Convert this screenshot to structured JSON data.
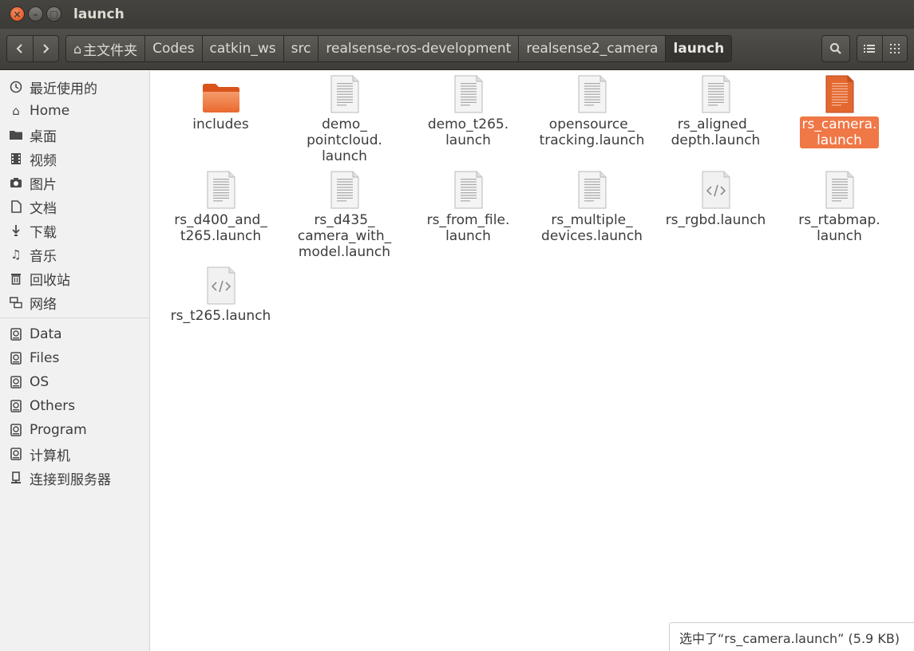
{
  "window": {
    "title": "launch"
  },
  "toolbar": {
    "breadcrumbs": [
      "主文件夹",
      "Codes",
      "catkin_ws",
      "src",
      "realsense-ros-development",
      "realsense2_camera",
      "launch"
    ]
  },
  "sidebar": {
    "places": [
      {
        "label": "最近使用的",
        "icon": "clock-icon"
      },
      {
        "label": "Home",
        "icon": "home-icon"
      },
      {
        "label": "桌面",
        "icon": "folder-icon"
      },
      {
        "label": "视频",
        "icon": "video-icon"
      },
      {
        "label": "图片",
        "icon": "camera-icon"
      },
      {
        "label": "文档",
        "icon": "document-icon"
      },
      {
        "label": "下载",
        "icon": "download-icon"
      },
      {
        "label": "音乐",
        "icon": "music-icon"
      },
      {
        "label": "回收站",
        "icon": "trash-icon"
      },
      {
        "label": "网络",
        "icon": "network-icon"
      }
    ],
    "devices": [
      {
        "label": "Data",
        "icon": "drive-icon"
      },
      {
        "label": "Files",
        "icon": "drive-icon"
      },
      {
        "label": "OS",
        "icon": "drive-icon"
      },
      {
        "label": "Others",
        "icon": "drive-icon"
      },
      {
        "label": "Program",
        "icon": "drive-icon"
      },
      {
        "label": "计算机",
        "icon": "drive-icon"
      },
      {
        "label": "连接到服务器",
        "icon": "server-icon"
      }
    ]
  },
  "files": [
    {
      "name": "includes",
      "lines": [
        "includes"
      ],
      "type": "folder"
    },
    {
      "name": "demo_pointcloud.launch",
      "lines": [
        "demo_",
        "pointcloud.",
        "launch"
      ],
      "type": "text"
    },
    {
      "name": "demo_t265.launch",
      "lines": [
        "demo_t265.",
        "launch"
      ],
      "type": "text"
    },
    {
      "name": "opensource_tracking.launch",
      "lines": [
        "opensource_",
        "tracking.launch"
      ],
      "type": "text"
    },
    {
      "name": "rs_aligned_depth.launch",
      "lines": [
        "rs_aligned_",
        "depth.launch"
      ],
      "type": "text"
    },
    {
      "name": "rs_camera.launch",
      "lines": [
        "rs_camera.",
        "launch"
      ],
      "type": "text",
      "selected": true
    },
    {
      "name": "rs_d400_and_t265.launch",
      "lines": [
        "rs_d400_and_",
        "t265.launch"
      ],
      "type": "text"
    },
    {
      "name": "rs_d435_camera_with_model.launch",
      "lines": [
        "rs_d435_",
        "camera_with_",
        "model.launch"
      ],
      "type": "text"
    },
    {
      "name": "rs_from_file.launch",
      "lines": [
        "rs_from_file.",
        "launch"
      ],
      "type": "text"
    },
    {
      "name": "rs_multiple_devices.launch",
      "lines": [
        "rs_multiple_",
        "devices.launch"
      ],
      "type": "text"
    },
    {
      "name": "rs_rgbd.launch",
      "lines": [
        "rs_rgbd.launch"
      ],
      "type": "xml"
    },
    {
      "name": "rs_rtabmap.launch",
      "lines": [
        "rs_rtabmap.",
        "launch"
      ],
      "type": "text"
    },
    {
      "name": "rs_t265.launch",
      "lines": [
        "rs_t265.launch"
      ],
      "type": "xml"
    }
  ],
  "status": {
    "text": "选中了“rs_camera.launch” (5.9 KB)"
  },
  "colors": {
    "accent": "#f07746",
    "titlebar": "#3c3b37",
    "sidebar": "#f1f1f1"
  }
}
